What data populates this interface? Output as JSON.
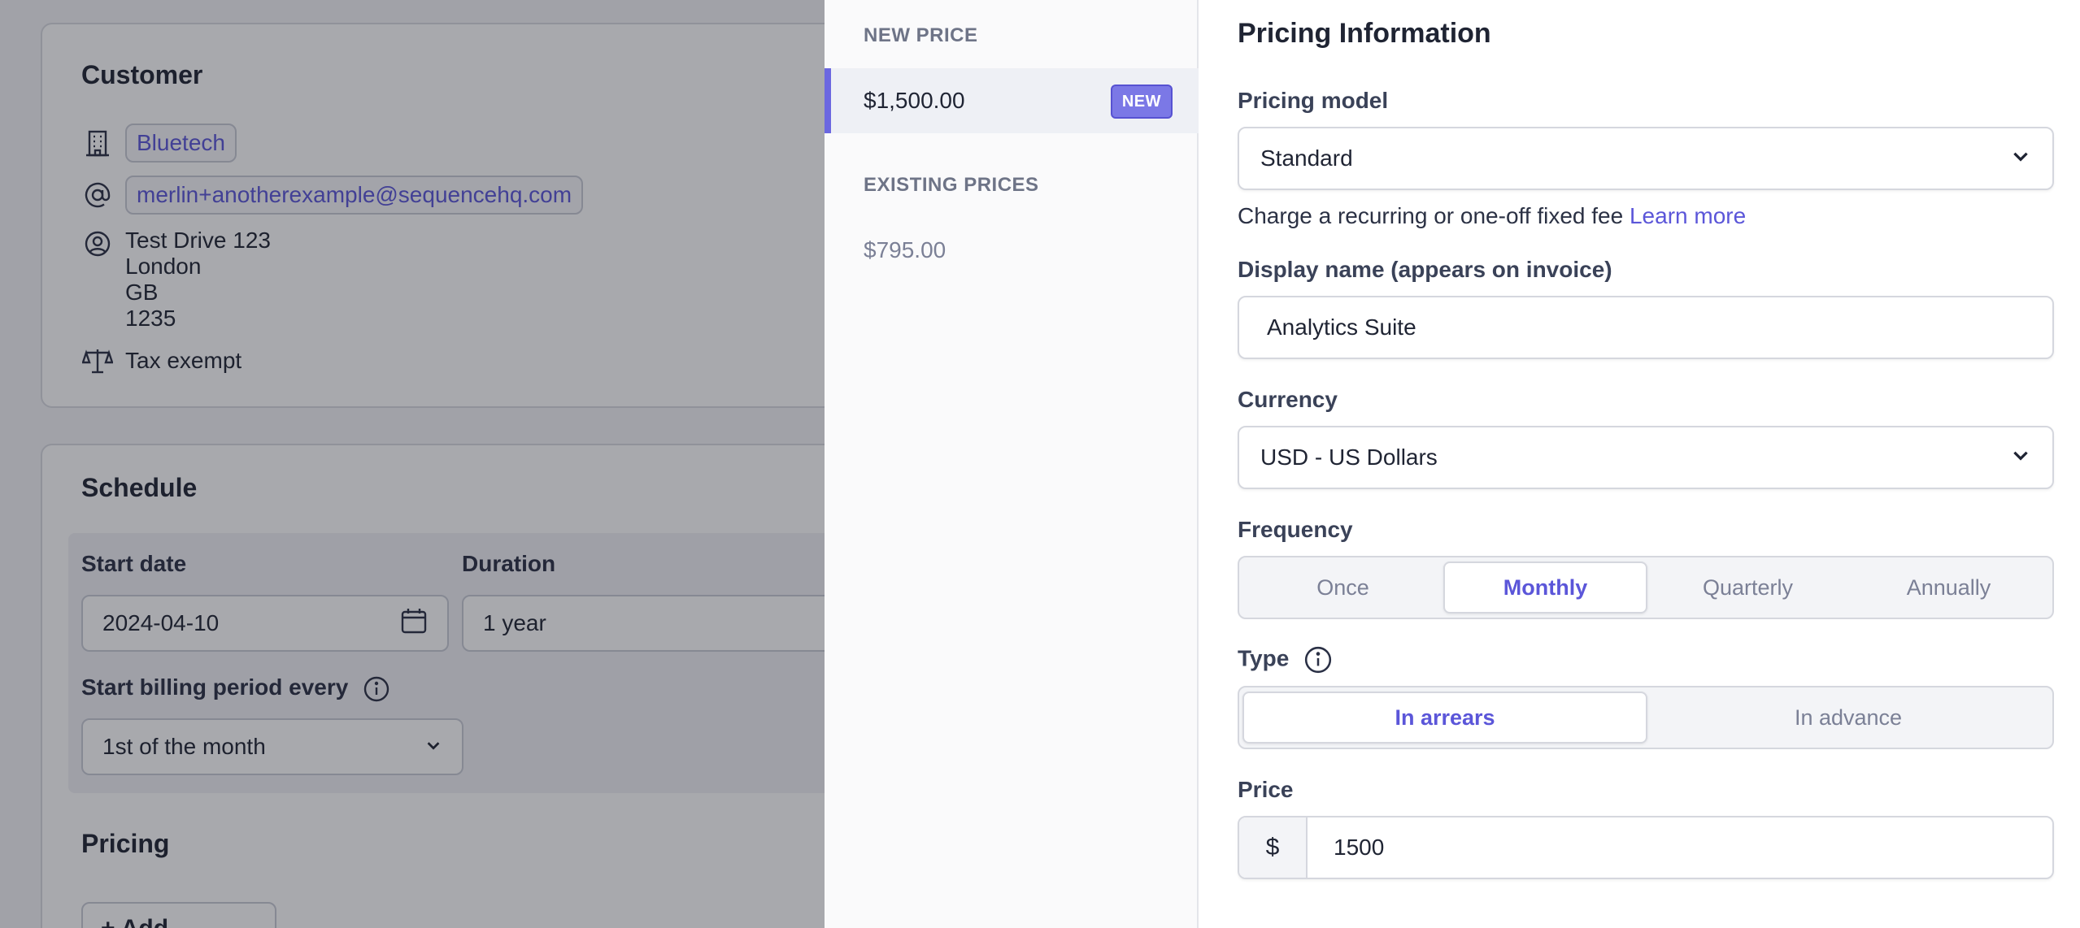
{
  "customer": {
    "title": "Customer",
    "company": "Bluetech",
    "email": "merlin+anotherexample@sequencehq.com",
    "address": [
      "Test Drive 123",
      "London",
      "GB",
      "1235"
    ],
    "tax_status": "Tax exempt"
  },
  "schedule": {
    "title": "Schedule",
    "start_date_label": "Start date",
    "start_date_value": "2024-04-10",
    "duration_label": "Duration",
    "duration_value": "1 year",
    "billing_label": "Start billing period every",
    "billing_value": "1st of the month",
    "pricing_title": "Pricing",
    "add_product_label": "+ Add product"
  },
  "price_list": {
    "new_heading": "NEW PRICE",
    "new_price": "$1,500.00",
    "new_badge": "NEW",
    "existing_heading": "EXISTING PRICES",
    "existing_prices": [
      "$795.00"
    ]
  },
  "form": {
    "title": "Pricing Information",
    "pricing_model_label": "Pricing model",
    "pricing_model_value": "Standard",
    "helper_text": "Charge a recurring or one-off fixed fee ",
    "helper_link": "Learn more",
    "display_name_label": "Display name (appears on invoice)",
    "display_name_value": "Analytics Suite",
    "currency_label": "Currency",
    "currency_value": "USD - US Dollars",
    "frequency_label": "Frequency",
    "frequency_options": [
      "Once",
      "Monthly",
      "Quarterly",
      "Annually"
    ],
    "frequency_selected": "Monthly",
    "type_label": "Type",
    "type_options": [
      "In arrears",
      "In advance"
    ],
    "type_selected": "In arrears",
    "price_label": "Price",
    "price_prefix": "$",
    "price_value": "1500"
  },
  "colors": {
    "accent": "#5b56d9",
    "badge": "#7b78e6",
    "overlay": "rgba(25,28,40,0.38)"
  }
}
